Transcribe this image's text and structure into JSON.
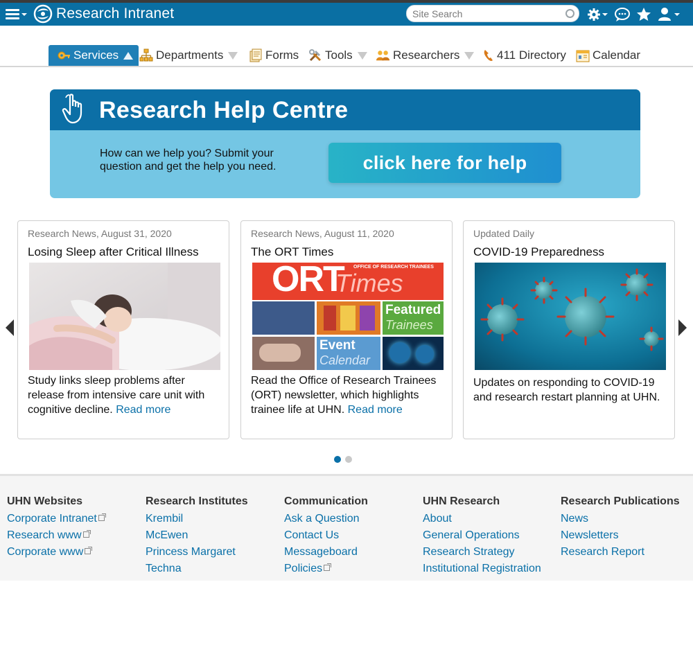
{
  "header": {
    "brand": "Research Intranet",
    "search_placeholder": "Site Search"
  },
  "nav": {
    "items": [
      {
        "label": "Services",
        "active": true
      },
      {
        "label": "Departments"
      },
      {
        "label": "Forms"
      },
      {
        "label": "Tools"
      },
      {
        "label": "Researchers"
      },
      {
        "label": "411 Directory"
      },
      {
        "label": "Calendar"
      }
    ]
  },
  "help_banner": {
    "title": "Research Help Centre",
    "text": "How can we help you? Submit your question and get the help you need.",
    "button_label": "click here for help"
  },
  "cards": [
    {
      "meta": "Research News, August 31, 2020",
      "title": "Losing Sleep after Critical Illness",
      "body": "Study links sleep problems after release from intensive care unit with cognitive decline.",
      "link": "Read more"
    },
    {
      "meta": "Research News, August 11, 2020",
      "title": "The ORT Times",
      "body": "Read the Office of Research Trainees (ORT) newsletter, which highlights trainee life at UHN.",
      "link": "Read more",
      "image_text": {
        "banner_small": "OFFICE OF RESEARCH TRAINEES",
        "ort": "ORT",
        "times": "Times",
        "featured": "Featured",
        "trainees": "Trainees",
        "event": "Event",
        "calendar": "Calendar"
      }
    },
    {
      "meta": "Updated Daily",
      "title": "COVID-19 Preparedness",
      "body": "Updates on responding to COVID-19 and research restart planning at UHN."
    }
  ],
  "footer": {
    "columns": [
      {
        "heading": "UHN Websites",
        "links": [
          "Corporate Intranet",
          "Research www",
          "Corporate www"
        ]
      },
      {
        "heading": "Research Institutes",
        "links": [
          "Krembil",
          "McEwen",
          "Princess Margaret",
          "Techna"
        ]
      },
      {
        "heading": "Communication",
        "links": [
          "Ask a Question",
          "Contact Us",
          "Messageboard",
          "Policies"
        ]
      },
      {
        "heading": "UHN Research",
        "links": [
          "About",
          "General Operations",
          "Research Strategy",
          "Institutional Registration"
        ]
      },
      {
        "heading": "Research Publications",
        "links": [
          "News",
          "Newsletters",
          "Research Report"
        ]
      }
    ]
  },
  "colors": {
    "topbar": "#0a6fa3",
    "nav_active": "#1f7fb6",
    "link": "#0a70a8",
    "banner_light": "#74c6e4",
    "banner_dark": "#0c6fa6"
  },
  "icons": [
    "menu-icon",
    "uhn-logo-icon",
    "search-icon",
    "gear-icon",
    "chat-icon",
    "star-icon",
    "user-icon"
  ]
}
